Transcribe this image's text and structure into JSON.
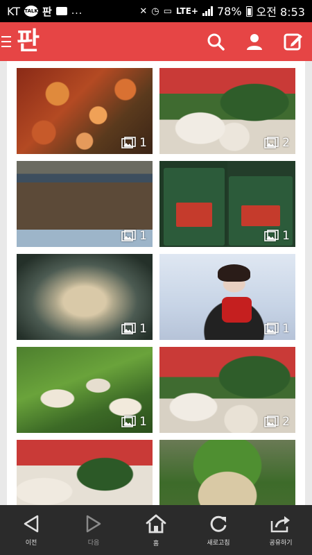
{
  "status_bar": {
    "carrier": "KT",
    "talk_badge": "TALK",
    "pan_badge": "판",
    "more": "...",
    "network": "LTE+",
    "battery": "78%",
    "time": "오전 8:53"
  },
  "app_bar": {
    "logo": "판",
    "colors": {
      "accent": "#e64545"
    },
    "actions": [
      {
        "icon": "search-icon"
      },
      {
        "icon": "user-icon"
      },
      {
        "icon": "write-icon"
      }
    ]
  },
  "gallery": {
    "tiles": [
      {
        "image": "kimchi-radish-leaves",
        "count": "1"
      },
      {
        "image": "radishes-in-red-basket",
        "count": "2"
      },
      {
        "image": "dirt-field",
        "count": "1"
      },
      {
        "image": "kimchi-bags",
        "count": "1"
      },
      {
        "image": "powdered-wig-portrait",
        "count": "1"
      },
      {
        "image": "man-red-scarf",
        "count": "1"
      },
      {
        "image": "radishes-on-grass",
        "count": "1"
      },
      {
        "image": "radishes-in-red-basket",
        "count": "2"
      },
      {
        "image": "radishes-in-red-basket",
        "count": ""
      },
      {
        "image": "radish-pile",
        "count": ""
      }
    ]
  },
  "bottom_nav": {
    "items": [
      {
        "label": "이전",
        "icon": "back-arrow-icon"
      },
      {
        "label": "다음",
        "icon": "forward-arrow-icon"
      },
      {
        "label": "홈",
        "icon": "home-icon"
      },
      {
        "label": "새로고침",
        "icon": "refresh-icon"
      },
      {
        "label": "공유하기",
        "icon": "share-icon"
      }
    ]
  }
}
